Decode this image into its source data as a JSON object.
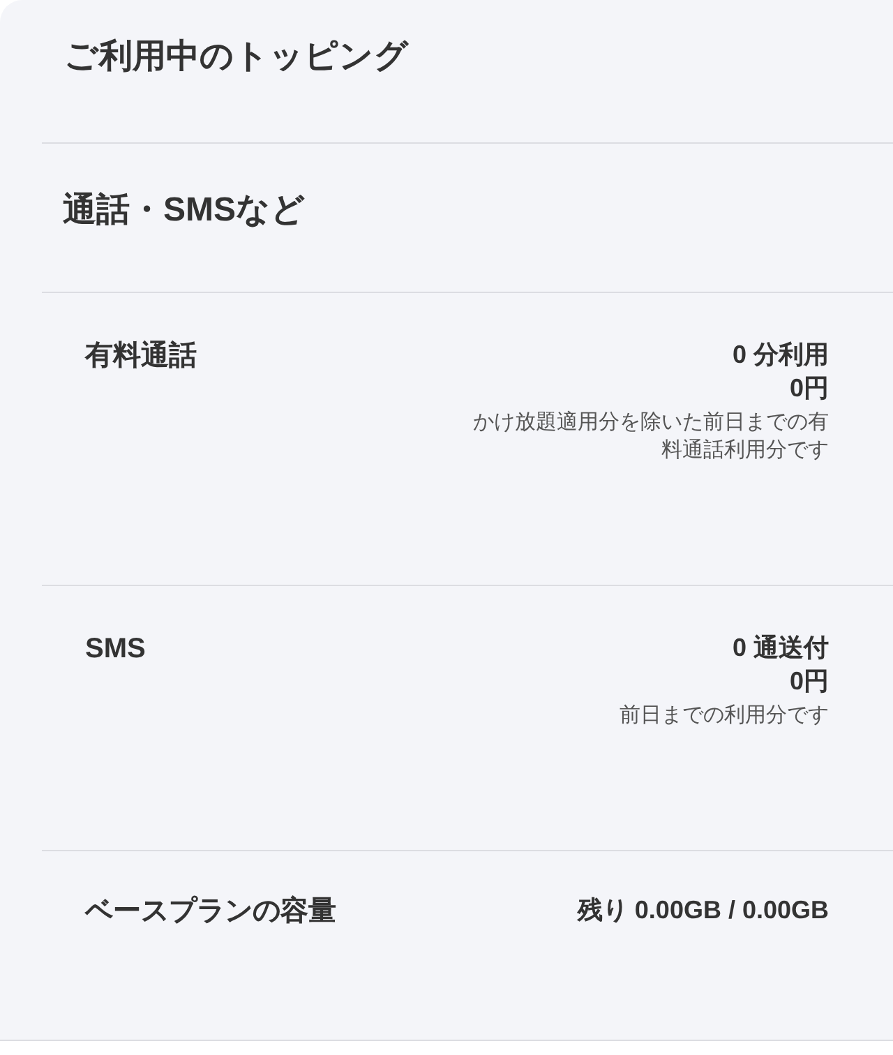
{
  "title": "ご利用中のトッピング",
  "section_title": "通話・SMSなど",
  "items": [
    {
      "label": "有料通話",
      "values": [
        "0 分利用",
        "0円"
      ],
      "note": "かけ放題適用分を除いた前日までの有料通話利用分です"
    },
    {
      "label": "SMS",
      "values": [
        "0 通送付",
        "0円"
      ],
      "note": "前日までの利用分です"
    },
    {
      "label": "ベースプランの容量",
      "values": [
        "残り 0.00GB / 0.00GB"
      ]
    }
  ]
}
